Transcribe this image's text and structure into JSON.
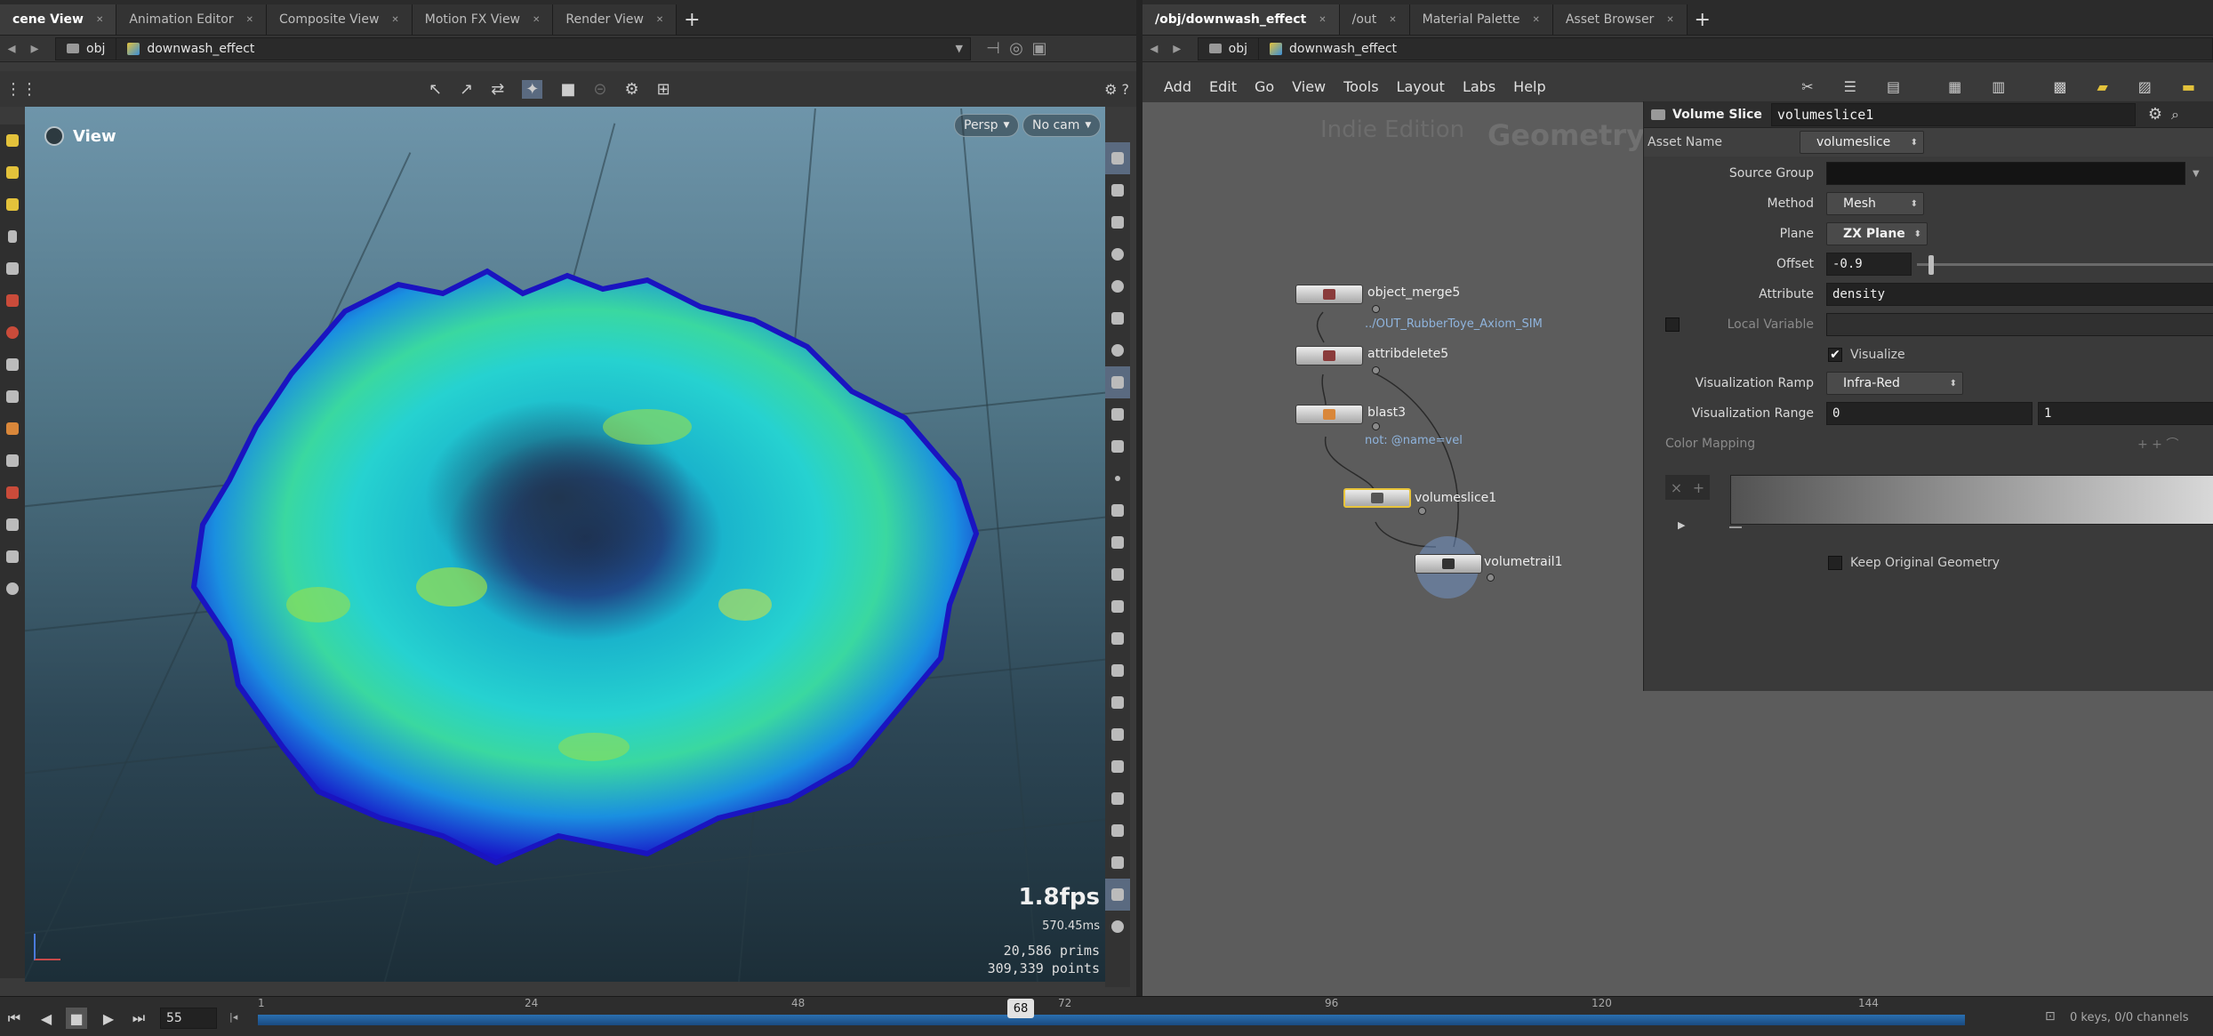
{
  "left_tabs": [
    {
      "label": "cene View",
      "active": true
    },
    {
      "label": "Animation Editor",
      "active": false
    },
    {
      "label": "Composite View",
      "active": false
    },
    {
      "label": "Motion FX View",
      "active": false
    },
    {
      "label": "Render View",
      "active": false
    }
  ],
  "right_tabs": [
    {
      "label": "/obj/downwash_effect",
      "active": true
    },
    {
      "label": "/out",
      "active": false
    },
    {
      "label": "Material Palette",
      "active": false
    },
    {
      "label": "Asset Browser",
      "active": false
    }
  ],
  "left_path": {
    "root": "obj",
    "node": "downwash_effect"
  },
  "right_path": {
    "root": "obj",
    "node": "downwash_effect"
  },
  "viewport": {
    "title": "View",
    "persp_label": "Persp",
    "cam_label": "No cam",
    "fps": "1.8fps",
    "ms": "570.45ms",
    "prims": "20,586  prims",
    "points": "309,339 points"
  },
  "menu": [
    "Add",
    "Edit",
    "Go",
    "View",
    "Tools",
    "Layout",
    "Labs",
    "Help"
  ],
  "network": {
    "watermark_edition": "Indie Edition",
    "watermark_context": "Geometry",
    "nodes": [
      {
        "name": "object_merge5",
        "sub": "../OUT_RubberToye_Axiom_SIM"
      },
      {
        "name": "attribdelete5",
        "sub": ""
      },
      {
        "name": "blast3",
        "sub": "not: @name=vel"
      },
      {
        "name": "volumeslice1",
        "sub": ""
      },
      {
        "name": "volumetrail1",
        "sub": ""
      }
    ]
  },
  "params": {
    "node_type": "Volume Slice",
    "node_name": "volumeslice1",
    "asset_name_label": "Asset Name",
    "asset_name_value": "volumeslice",
    "source_group_label": "Source Group",
    "source_group_value": "",
    "method_label": "Method",
    "method_value": "Mesh",
    "plane_label": "Plane",
    "plane_value": "ZX Plane",
    "offset_label": "Offset",
    "offset_value": "-0.9",
    "attribute_label": "Attribute",
    "attribute_value": "density",
    "local_variable_label": "Local Variable",
    "visualize_label": "Visualize",
    "vis_ramp_label": "Visualization Ramp",
    "vis_ramp_value": "Infra-Red",
    "vis_range_label": "Visualization Range",
    "vis_range_min": "0",
    "vis_range_max": "1",
    "color_mapping_label": "Color Mapping",
    "keep_original_label": "Keep Original Geometry"
  },
  "timeline": {
    "frame_field": "55",
    "current_frame": "68",
    "ticks": [
      "1",
      "24",
      "48",
      "72",
      "96",
      "120",
      "144"
    ],
    "keys_label": "0 keys, 0/0 channels"
  }
}
